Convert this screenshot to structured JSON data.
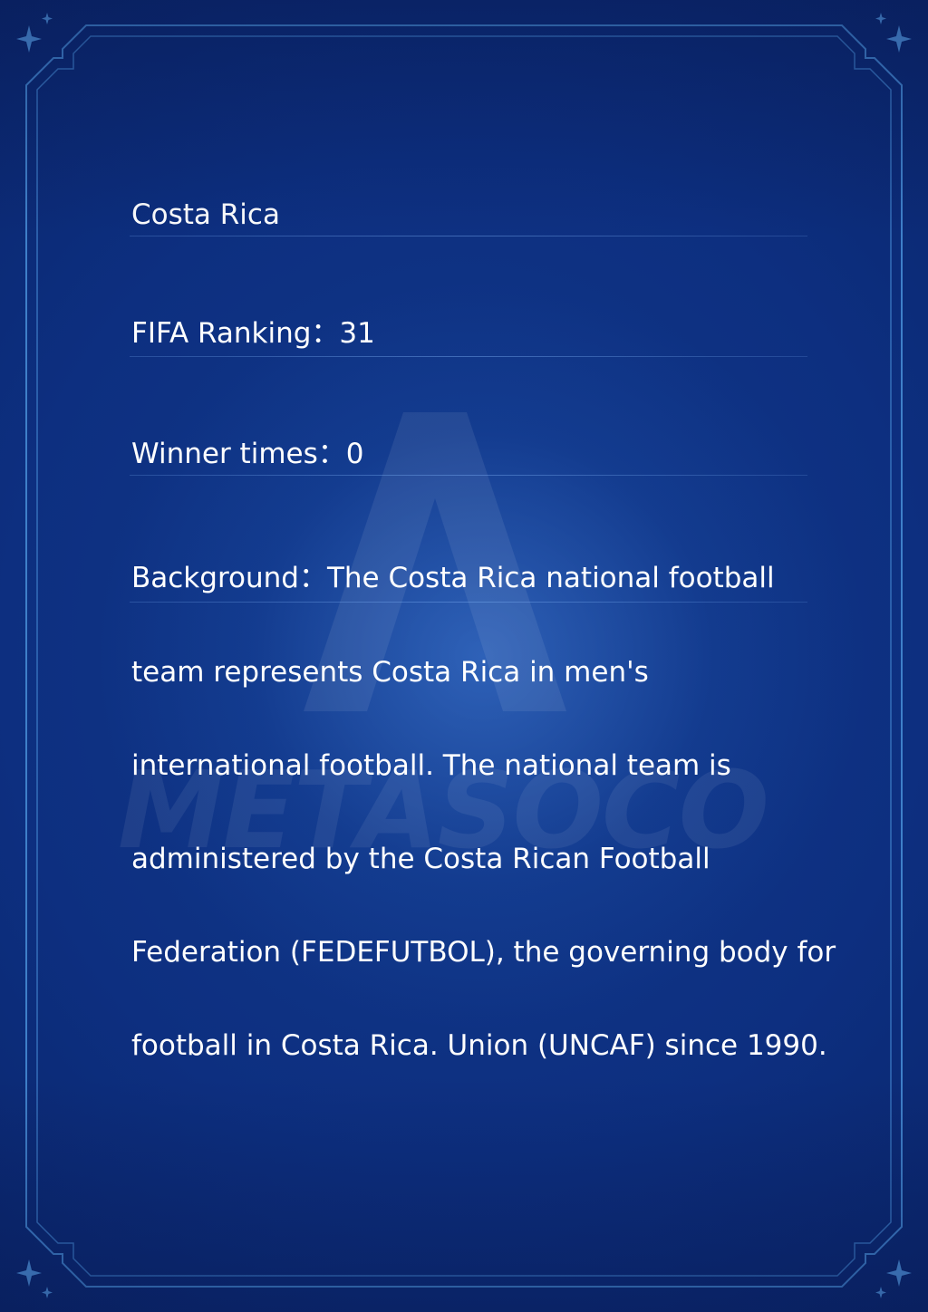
{
  "team": {
    "name": "Costa Rica",
    "ranking": "FIFA Ranking：31",
    "winner": "Winner times：0",
    "background_lines": [
      "Background：The Costa Rica national football",
      "team represents Costa Rica in men's",
      "international football. The national team is",
      "administered by the Costa Rican Football",
      "Federation (FEDEFUTBOL), the governing body for",
      "football in Costa Rica. Union (UNCAF) since 1990."
    ]
  },
  "watermark": {
    "text": "METASOCO"
  },
  "colors": {
    "background": "#0d2f80",
    "frame": "#3f7fc9",
    "text": "#ffffff"
  }
}
